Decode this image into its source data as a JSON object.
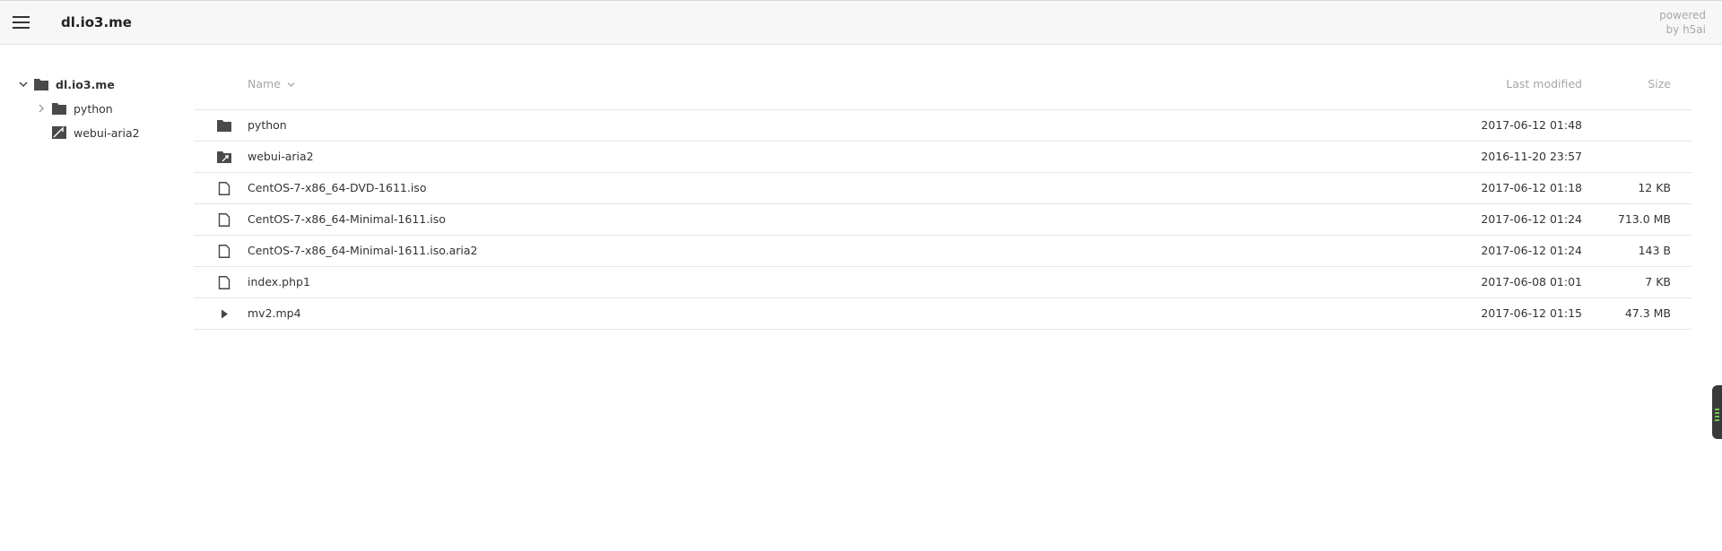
{
  "header": {
    "title": "dl.io3.me",
    "powered_line1": "powered",
    "powered_line2": "by h5ai"
  },
  "tree": {
    "root": {
      "label": "dl.io3.me",
      "icon": "folder-icon",
      "expanded": true
    },
    "children": [
      {
        "label": "python",
        "icon": "folder-icon",
        "has_children": true
      },
      {
        "label": "webui-aria2",
        "icon": "folder-link-icon",
        "has_children": false
      }
    ]
  },
  "list": {
    "columns": {
      "name": "Name",
      "modified": "Last modified",
      "size": "Size"
    },
    "rows": [
      {
        "icon": "folder-icon",
        "name": "python",
        "modified": "2017-06-12 01:48",
        "size": ""
      },
      {
        "icon": "folder-link-icon",
        "name": "webui-aria2",
        "modified": "2016-11-20 23:57",
        "size": ""
      },
      {
        "icon": "file-icon",
        "name": "CentOS-7-x86_64-DVD-1611.iso",
        "modified": "2017-06-12 01:18",
        "size": "12 KB"
      },
      {
        "icon": "file-icon",
        "name": "CentOS-7-x86_64-Minimal-1611.iso",
        "modified": "2017-06-12 01:24",
        "size": "713.0 MB"
      },
      {
        "icon": "file-icon",
        "name": "CentOS-7-x86_64-Minimal-1611.iso.aria2",
        "modified": "2017-06-12 01:24",
        "size": "143 B"
      },
      {
        "icon": "file-icon",
        "name": "index.php1",
        "modified": "2017-06-08 01:01",
        "size": "7 KB"
      },
      {
        "icon": "video-play-icon",
        "name": "mv2.mp4",
        "modified": "2017-06-12 01:15",
        "size": "47.3 MB"
      }
    ]
  },
  "colors": {
    "header_bg": "#f7f7f7",
    "text": "#333333",
    "muted": "#a6a6a6",
    "divider": "#e6e6e6"
  }
}
